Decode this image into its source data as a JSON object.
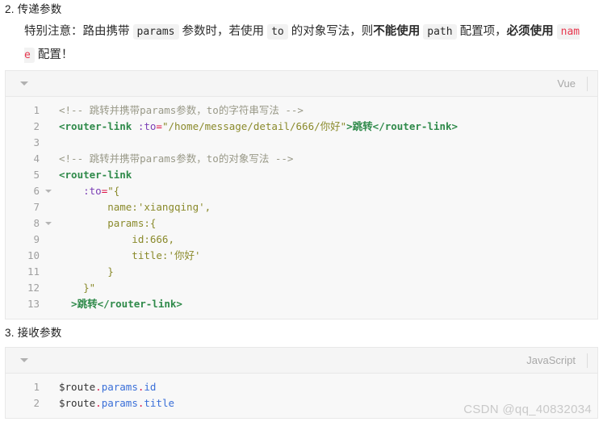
{
  "section_pass": {
    "heading": "2. 传递参数",
    "notice": {
      "prefix": "特别注意：路由携带 ",
      "code_params": "params",
      "mid1": " 参数时，若使用 ",
      "code_to": "to",
      "mid2": " 的对象写法，则",
      "bold1": "不能使用",
      "mid3": " ",
      "code_path": "path",
      "mid4": " 配置项，",
      "bold2": "必须使用",
      "mid5": " ",
      "code_name": "name",
      "suffix": " 配置！"
    },
    "codeblock": {
      "lang": "Vue",
      "fold_icon": "caret-down-icon",
      "line_numbers": [
        "1",
        "2",
        "3",
        "4",
        "5",
        "6",
        "7",
        "8",
        "9",
        "10",
        "11",
        "12",
        "13"
      ],
      "fold_lines": [
        6,
        8
      ],
      "lines": [
        [
          {
            "t": "com",
            "v": "<!-- 跳转并携带params参数，to的字符串写法 -->"
          }
        ],
        [
          {
            "t": "tag",
            "v": "<router-link"
          },
          {
            "t": "plain",
            "v": " "
          },
          {
            "t": "attr",
            "v": ":to"
          },
          {
            "t": "op",
            "v": "="
          },
          {
            "t": "str",
            "v": "\"/home/message/detail/666/你好\""
          },
          {
            "t": "tag",
            "v": ">跳转</router-link>"
          }
        ],
        [],
        [
          {
            "t": "com",
            "v": "<!-- 跳转并携带params参数，to的对象写法 -->"
          }
        ],
        [
          {
            "t": "tag",
            "v": "<router-link"
          }
        ],
        [
          {
            "t": "plain",
            "v": "    "
          },
          {
            "t": "attr",
            "v": ":to"
          },
          {
            "t": "op",
            "v": "="
          },
          {
            "t": "str",
            "v": "\"{"
          }
        ],
        [
          {
            "t": "prop",
            "v": "        name:'xiangqing',"
          }
        ],
        [
          {
            "t": "prop",
            "v": "        params:{"
          }
        ],
        [
          {
            "t": "prop",
            "v": "            id:666,"
          }
        ],
        [
          {
            "t": "prop",
            "v": "            title:'你好'"
          }
        ],
        [
          {
            "t": "prop",
            "v": "        }"
          }
        ],
        [
          {
            "t": "prop",
            "v": "    }\""
          }
        ],
        [
          {
            "t": "tag",
            "v": "  >跳转</router-link>"
          }
        ]
      ]
    }
  },
  "section_receive": {
    "heading": "3. 接收参数",
    "codeblock": {
      "lang": "JavaScript",
      "fold_icon": "caret-down-icon",
      "line_numbers": [
        "1",
        "2"
      ],
      "fold_lines": [],
      "lines": [
        [
          {
            "t": "var",
            "v": "$route"
          },
          {
            "t": "dot",
            "v": "."
          },
          {
            "t": "blue",
            "v": "params"
          },
          {
            "t": "dot",
            "v": "."
          },
          {
            "t": "blue",
            "v": "id"
          }
        ],
        [
          {
            "t": "var",
            "v": "$route"
          },
          {
            "t": "dot",
            "v": "."
          },
          {
            "t": "blue",
            "v": "params"
          },
          {
            "t": "dot",
            "v": "."
          },
          {
            "t": "blue",
            "v": "title"
          }
        ]
      ]
    }
  },
  "watermark": "CSDN @qq_40832034",
  "colors": {
    "inline_code_bg": "#f2f2f2",
    "inline_code_red": "#e8384f",
    "codeblock_bg": "#f8f8f8",
    "codeblock_border": "#e8e8e8",
    "gutter_text": "#a0a0a0",
    "lang_label": "#a8a8a8",
    "watermark": "#c9c9c9"
  }
}
